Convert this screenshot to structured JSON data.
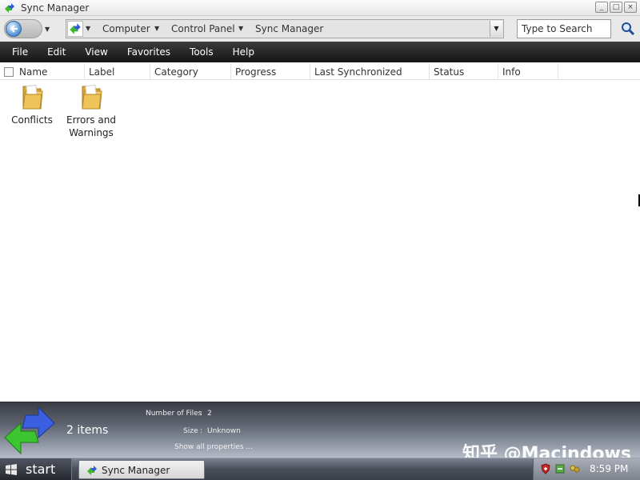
{
  "window": {
    "title": "Sync Manager",
    "controls": [
      "_",
      "□",
      "×"
    ]
  },
  "address_bar": {
    "breadcrumbs": [
      "Computer",
      "Control Panel",
      "Sync Manager"
    ],
    "search_placeholder": "Type to Search"
  },
  "menu": [
    "File",
    "Edit",
    "View",
    "Favorites",
    "Tools",
    "Help"
  ],
  "columns": [
    "Name",
    "Label",
    "Category",
    "Progress",
    "Last Synchronized",
    "Status",
    "Info"
  ],
  "items": [
    {
      "label_line1": "Conflicts",
      "label_line2": "",
      "icon": "folder-icon"
    },
    {
      "label_line1": "Errors and",
      "label_line2": "Warnings",
      "icon": "folder-icon"
    }
  ],
  "details": {
    "count": "2 items",
    "files_label": "Number of Files",
    "files_value": "2",
    "size_label": "Size",
    "size_value": "Unknown",
    "show_all": "Show all properties ...",
    "watermark": "知乎 @Macindows"
  },
  "taskbar": {
    "start_label": "start",
    "task": "Sync Manager",
    "clock": "8:59 PM"
  },
  "colors": {
    "menubar": "#1f1f1f",
    "details_top": "#3a3d45",
    "folder": "#e8c35a",
    "sync_green": "#3cb832",
    "sync_blue": "#2f5bd6"
  }
}
